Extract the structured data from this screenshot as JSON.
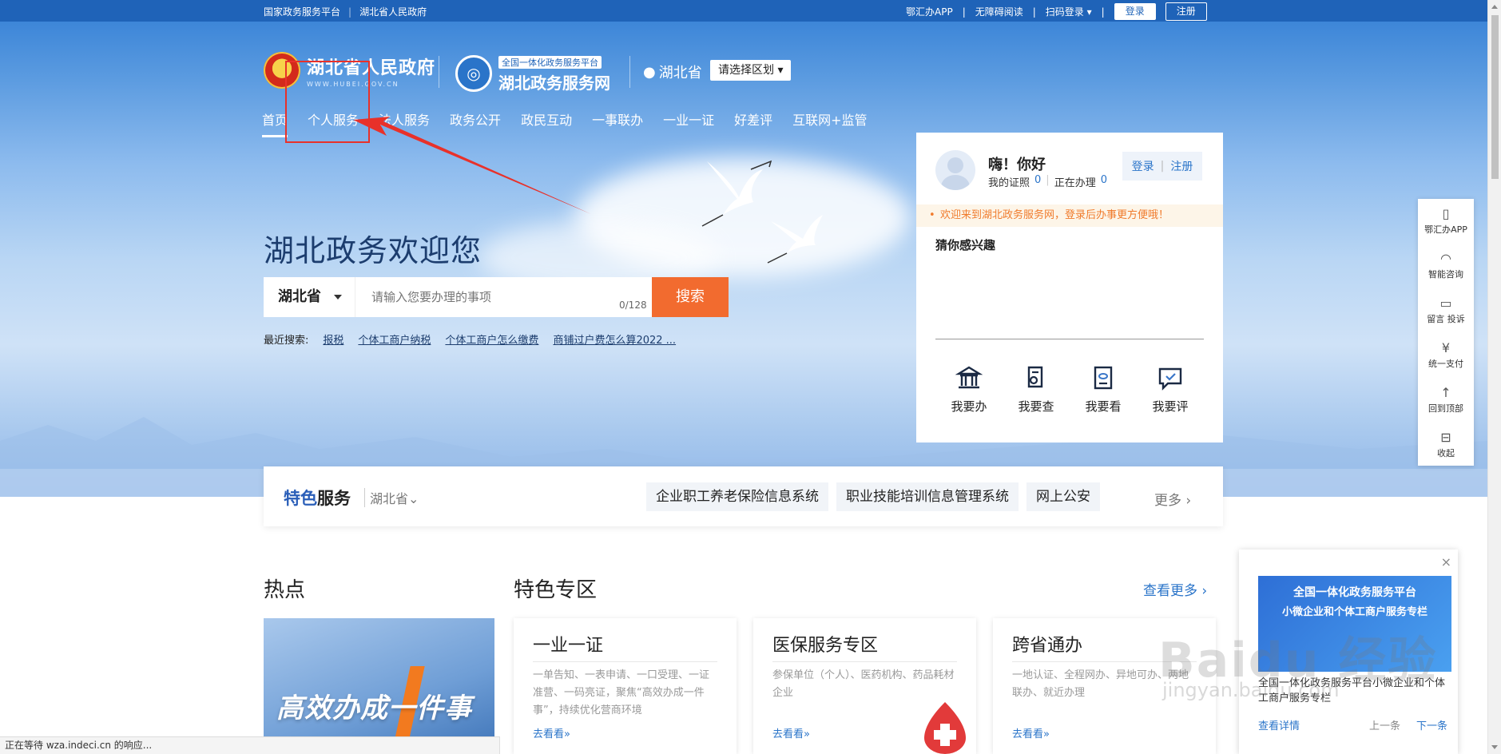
{
  "topbar": {
    "left_links": [
      "国家政务服务平台",
      "湖北省人民政府"
    ],
    "right_links": [
      "鄂汇办APP",
      "无障碍阅读",
      "扫码登录"
    ],
    "login_label": "登录",
    "register_label": "注册"
  },
  "header": {
    "gov_title": "湖北省人民政府",
    "gov_url": "WWW.HUBEI.GOV.CN",
    "platform_badge": "全国一体化政务服务平台",
    "platform_title": "湖北政务服务网",
    "region": "湖北省",
    "region_select": "请选择区划"
  },
  "nav": {
    "items": [
      "首页",
      "个人服务",
      "法人服务",
      "政务公开",
      "政民互动",
      "一事联办",
      "一业一证",
      "好差评",
      "互联网+监管"
    ],
    "active_index": 0
  },
  "hero": {
    "title": "湖北政务欢迎您",
    "search_province": "湖北省",
    "search_placeholder": "请输入您要办理的事项",
    "search_count": "0/128",
    "search_button": "搜索",
    "recent_label": "最近搜索:",
    "recent_items": [
      "报税",
      "个体工商户纳税",
      "个体工商户怎么缴费",
      "商铺过户费怎么算2022 ..."
    ]
  },
  "user_panel": {
    "greeting": "嗨！你好",
    "certs_label": "我的证照",
    "certs_value": "0",
    "doing_label": "正在办理",
    "doing_value": "0",
    "login": "登录",
    "register": "注册",
    "notice": "欢迎来到湖北政务服务网，登录后办事更方便哦！",
    "guess_title": "猜你感兴趣",
    "actions": [
      "我要办",
      "我要查",
      "我要看",
      "我要评"
    ]
  },
  "feature": {
    "title_a": "特色",
    "title_b": "服务",
    "region": "湖北省",
    "tags": [
      "企业职工养老保险信息系统",
      "职业技能培训信息管理系统",
      "网上公安"
    ],
    "more": "更多"
  },
  "sections": {
    "hot_title": "热点",
    "hot_image_text": "高效办成一件事",
    "zone_title": "特色专区",
    "see_more": "查看更多",
    "cards": [
      {
        "title": "一业一证",
        "desc": "一单告知、一表申请、一口受理、一证准营、一码亮证，聚焦“高效办成一件事”，持续优化营商环境",
        "link": "去看看"
      },
      {
        "title": "医保服务专区",
        "desc": "参保单位（个人）、医药机构、药品耗材企业",
        "link": "去看看"
      },
      {
        "title": "跨省通办",
        "desc": "一地认证、全程网办、异地可办、两地联办、就近办理",
        "link": "去看看"
      }
    ]
  },
  "tools": [
    "鄂汇办APP",
    "智能咨询",
    "留言 投诉",
    "统一支付",
    "回到顶部",
    "收起"
  ],
  "popup": {
    "banner_line1": "全国一体化政务服务平台",
    "banner_line2": "小微企业和个体工商户服务专栏",
    "text": "全国一体化政务服务平台小微企业和个体工商户服务专栏",
    "detail": "查看详情",
    "prev": "上一条",
    "next": "下一条"
  },
  "watermark": {
    "brand": "Baidu 经验",
    "url": "jingyan.baidu.com"
  },
  "status_bar": "正在等待 wza.indeci.cn 的响应...",
  "colors": {
    "brand_blue": "#1f63b8",
    "accent_orange": "#f26b2f",
    "annotation_red": "#e8312a"
  }
}
